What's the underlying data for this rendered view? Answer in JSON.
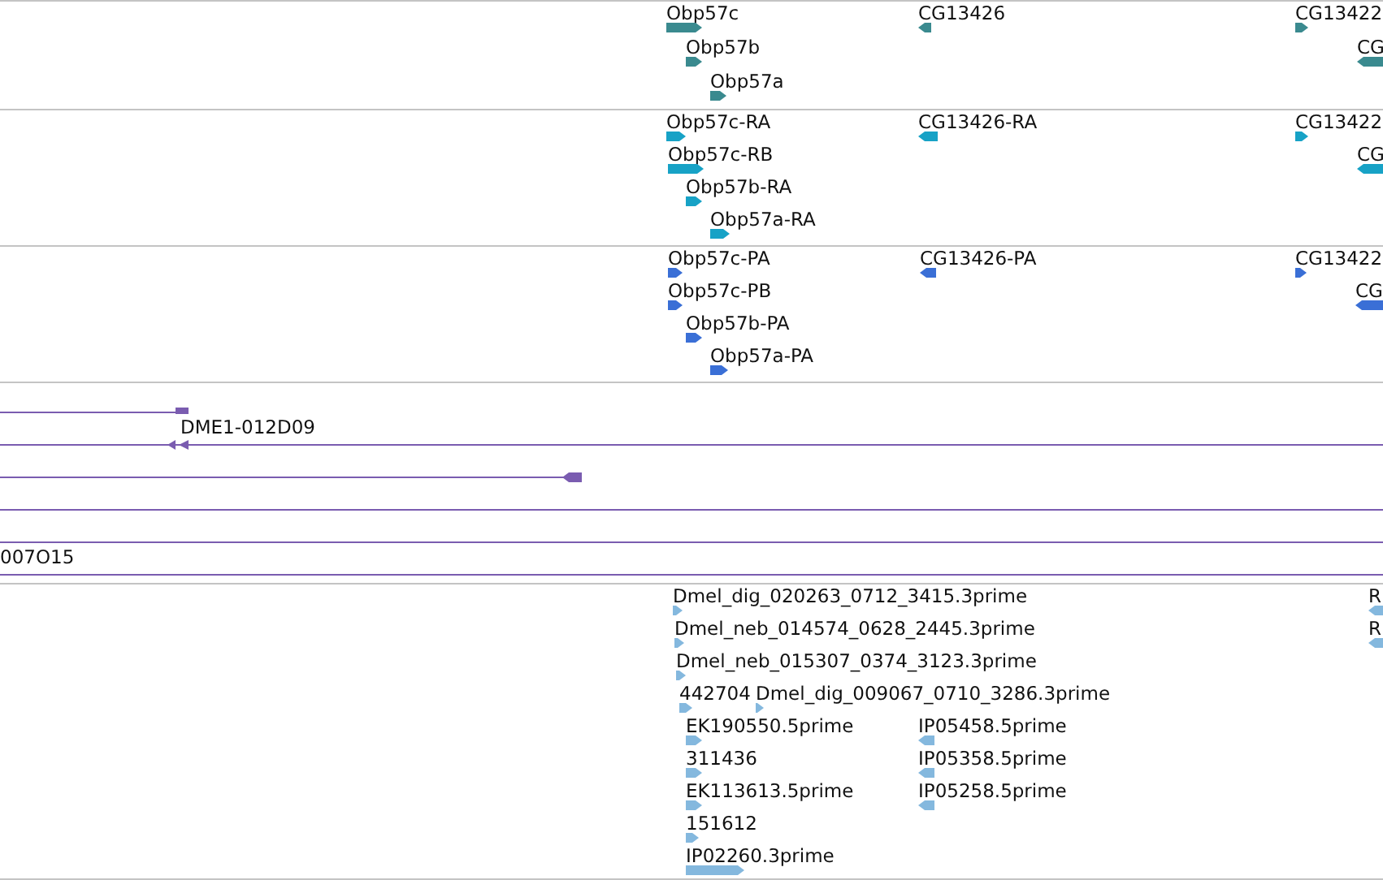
{
  "tracks": [
    {
      "kind": "genes",
      "color": "#3a8a8f",
      "features": [
        {
          "label": "Obp57c",
          "kind": "forward"
        },
        {
          "label": "Obp57b",
          "kind": "forward"
        },
        {
          "label": "Obp57a",
          "kind": "forward"
        },
        {
          "label": "CG13426",
          "kind": "reverse"
        },
        {
          "label": "CG13422",
          "kind": "forward"
        },
        {
          "label": "CG",
          "kind": "reverse"
        }
      ]
    },
    {
      "kind": "genes",
      "color": "#17a2c6",
      "features": [
        {
          "label": "Obp57c-RA",
          "kind": "forward"
        },
        {
          "label": "Obp57c-RB",
          "kind": "forward"
        },
        {
          "label": "Obp57b-RA",
          "kind": "forward"
        },
        {
          "label": "Obp57a-RA",
          "kind": "forward"
        },
        {
          "label": "CG13426-RA",
          "kind": "reverse"
        },
        {
          "label": "CG13422",
          "kind": "forward"
        },
        {
          "label": "CG",
          "kind": "reverse"
        }
      ]
    },
    {
      "kind": "genes",
      "color": "#3a6fd6",
      "features": [
        {
          "label": "Obp57c-PA",
          "kind": "forward"
        },
        {
          "label": "Obp57c-PB",
          "kind": "forward"
        },
        {
          "label": "Obp57b-PA",
          "kind": "forward"
        },
        {
          "label": "Obp57a-PA",
          "kind": "forward"
        },
        {
          "label": "CG13426-PA",
          "kind": "reverse"
        },
        {
          "label": "CG13422",
          "kind": "forward"
        },
        {
          "label": "CG",
          "kind": "reverse"
        }
      ]
    },
    {
      "kind": "alignments",
      "color": "#7a5cb0",
      "features": [
        {
          "label": "DME1-012D09"
        },
        {
          "label": "007O15"
        }
      ]
    },
    {
      "kind": "genes",
      "color": "#84b8de",
      "features": [
        {
          "label": "Dmel_dig_020263_0712_3415.3prime",
          "kind": "forward"
        },
        {
          "label": "Dmel_neb_014574_0628_2445.3prime",
          "kind": "forward"
        },
        {
          "label": "Dmel_neb_015307_0374_3123.3prime",
          "kind": "forward"
        },
        {
          "label": "442704",
          "kind": "forward"
        },
        {
          "label": "Dmel_dig_009067_0710_3286.3prime",
          "kind": "forward"
        },
        {
          "label": "EK190550.5prime",
          "kind": "forward"
        },
        {
          "label": "311436",
          "kind": "forward"
        },
        {
          "label": "EK113613.5prime",
          "kind": "forward"
        },
        {
          "label": "151612",
          "kind": "forward"
        },
        {
          "label": "IP02260.3prime",
          "kind": "forward"
        },
        {
          "label": "IP05458.5prime",
          "kind": "reverse"
        },
        {
          "label": "IP05358.5prime",
          "kind": "reverse"
        },
        {
          "label": "IP05258.5prime",
          "kind": "reverse"
        },
        {
          "label": "R",
          "kind": "reverse"
        },
        {
          "label": "R",
          "kind": "reverse"
        }
      ]
    }
  ]
}
